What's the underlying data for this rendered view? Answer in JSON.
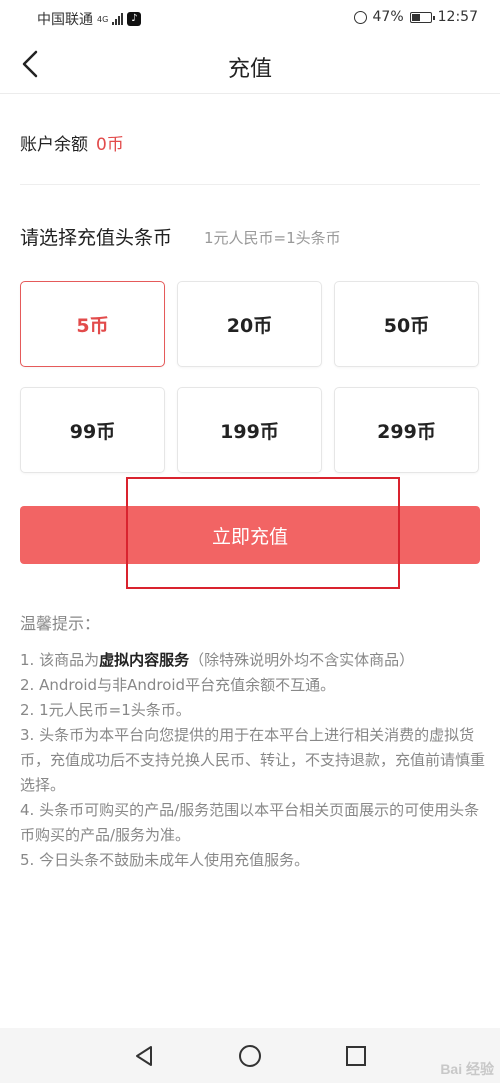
{
  "status_bar": {
    "carrier": "中国联通",
    "network": "4G",
    "battery": "47%",
    "battery_level": 0.47,
    "time": "12:57"
  },
  "header": {
    "title": "充值"
  },
  "balance": {
    "label": "账户余额",
    "amount": "0币"
  },
  "recharge": {
    "title": "请选择充值头条币",
    "rate": "1元人民币=1头条币",
    "options": [
      "5币",
      "20币",
      "50币",
      "99币",
      "199币",
      "299币"
    ],
    "selected_index": 0,
    "button_label": "立即充值"
  },
  "tips": {
    "title": "温馨提示：",
    "line1_prefix": "1. 该商品为",
    "line1_bold": "虚拟内容服务",
    "line1_suffix": "（除特殊说明外均不含实体商品）",
    "line2": "2. Android与非Android平台充值余额不互通。",
    "line3": "2. 1元人民币=1头条币。",
    "line4": "3. 头条币为本平台向您提供的用于在本平台上进行相关消费的虚拟货币，充值成功后不支持兑换人民币、转让，不支持退款，充值前请慎重选择。",
    "line5": "4. 头条币可购买的产品/服务范围以本平台相关页面展示的可使用头条币购买的产品/服务为准。",
    "line6": "5. 今日头条不鼓励未成年人使用充值服务。"
  },
  "watermark": "Bai 经验",
  "colors": {
    "accent": "#f26464",
    "price_red": "#e24b4b",
    "annotation_red": "#d9232e"
  }
}
